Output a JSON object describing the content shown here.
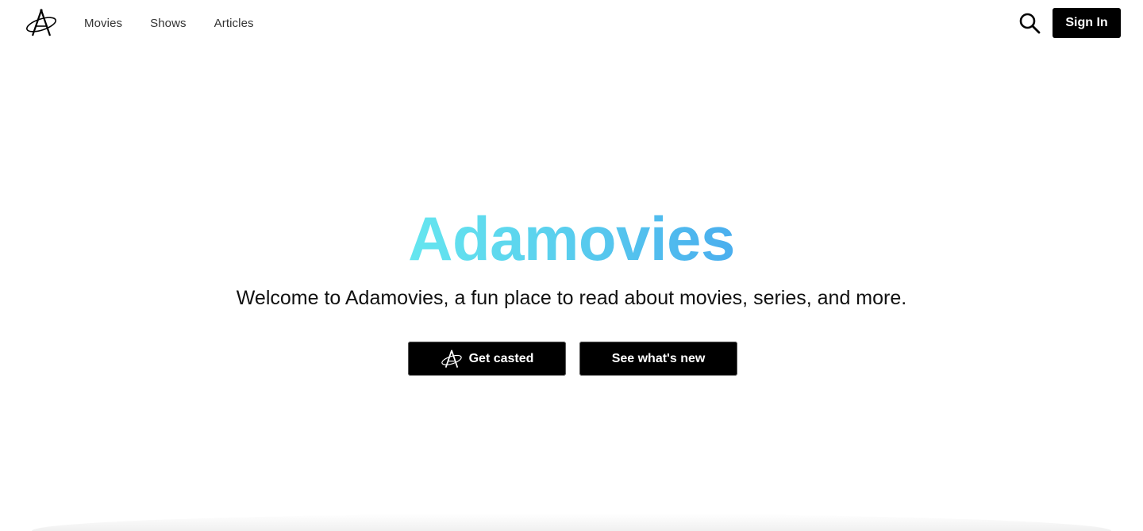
{
  "header": {
    "logo_name": "adamovies-logo",
    "nav": [
      {
        "label": "Movies"
      },
      {
        "label": "Shows"
      },
      {
        "label": "Articles"
      }
    ],
    "search_icon": "search-icon",
    "sign_in_label": "Sign In"
  },
  "hero": {
    "title": "Adamovies",
    "subtitle": "Welcome to Adamovies, a fun place to read about movies, series, and more.",
    "primary_button_label": "Get casted",
    "secondary_button_label": "See what's new"
  },
  "colors": {
    "background": "#ffffff",
    "button": "#000000",
    "button_text": "#ffffff",
    "title_gradient_start": "#65e6ef",
    "title_gradient_end": "#4aaeee"
  }
}
